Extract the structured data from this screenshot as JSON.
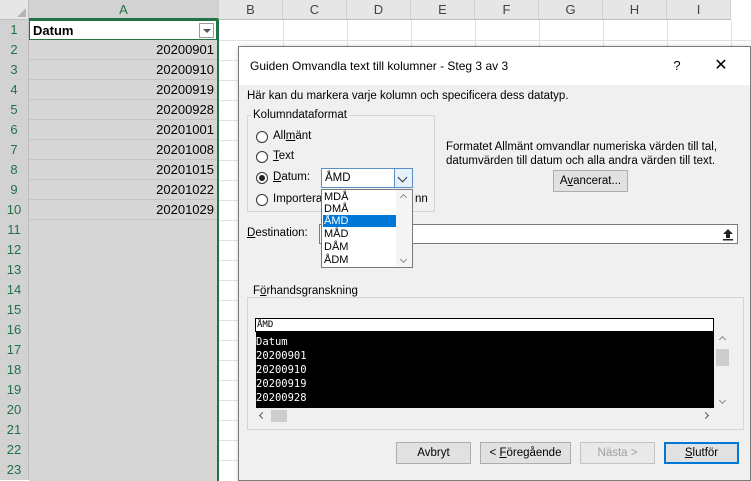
{
  "sheet": {
    "columns": [
      "A",
      "B",
      "C",
      "D",
      "E",
      "F",
      "G",
      "H",
      "I"
    ],
    "rows": [
      "1",
      "2",
      "3",
      "4",
      "5",
      "6",
      "7",
      "8",
      "9",
      "10",
      "11",
      "12",
      "13",
      "14",
      "15",
      "16",
      "17",
      "18",
      "19",
      "20",
      "21",
      "22",
      "23"
    ],
    "header_cell": "Datum",
    "values": [
      "20200901",
      "20200910",
      "20200919",
      "20200928",
      "20201001",
      "20201008",
      "20201015",
      "20201022",
      "20201029"
    ]
  },
  "dialog": {
    "title": "Guiden Omvandla text till kolumner - Steg 3 av 3",
    "help": "?",
    "close": "✕",
    "instruction": "Här kan du markera varje kolumn och specificera dess datatyp.",
    "group_title": "Kolumndataformat",
    "radio_general_pre": "All",
    "radio_general_u": "m",
    "radio_general_post": "änt",
    "radio_text_u": "T",
    "radio_text_post": "ext",
    "radio_date_u": "D",
    "radio_date_post": "atum:",
    "radio_skip_pre": "Importera",
    "radio_skip_tail": "nn",
    "date_selected": "ÅMD",
    "date_options": [
      "MDÅ",
      "DMÅ",
      "ÅMD",
      "MÅD",
      "DÅM",
      "ÅDM"
    ],
    "info_line1": "Formatet Allmänt omvandlar numeriska värden till tal,",
    "info_line2": "datumvärden till datum och alla andra värden till text.",
    "advanced_pre": "A",
    "advanced_u": "v",
    "advanced_post": "ancerat...",
    "destination_u": "D",
    "destination_post": "estination:",
    "preview_title_pre": "F",
    "preview_title_u": "ö",
    "preview_title_post": "rhandsgranskning",
    "preview_header": "ÅMD",
    "preview_rows": [
      "Datum",
      "20200901",
      "20200910",
      "20200919",
      "20200928"
    ],
    "buttons": {
      "cancel": "Avbryt",
      "previous_pre": "< ",
      "previous_u": "F",
      "previous_post": "öregående",
      "next": "Nästa >",
      "finish_u": "S",
      "finish_post": "lutför"
    }
  }
}
